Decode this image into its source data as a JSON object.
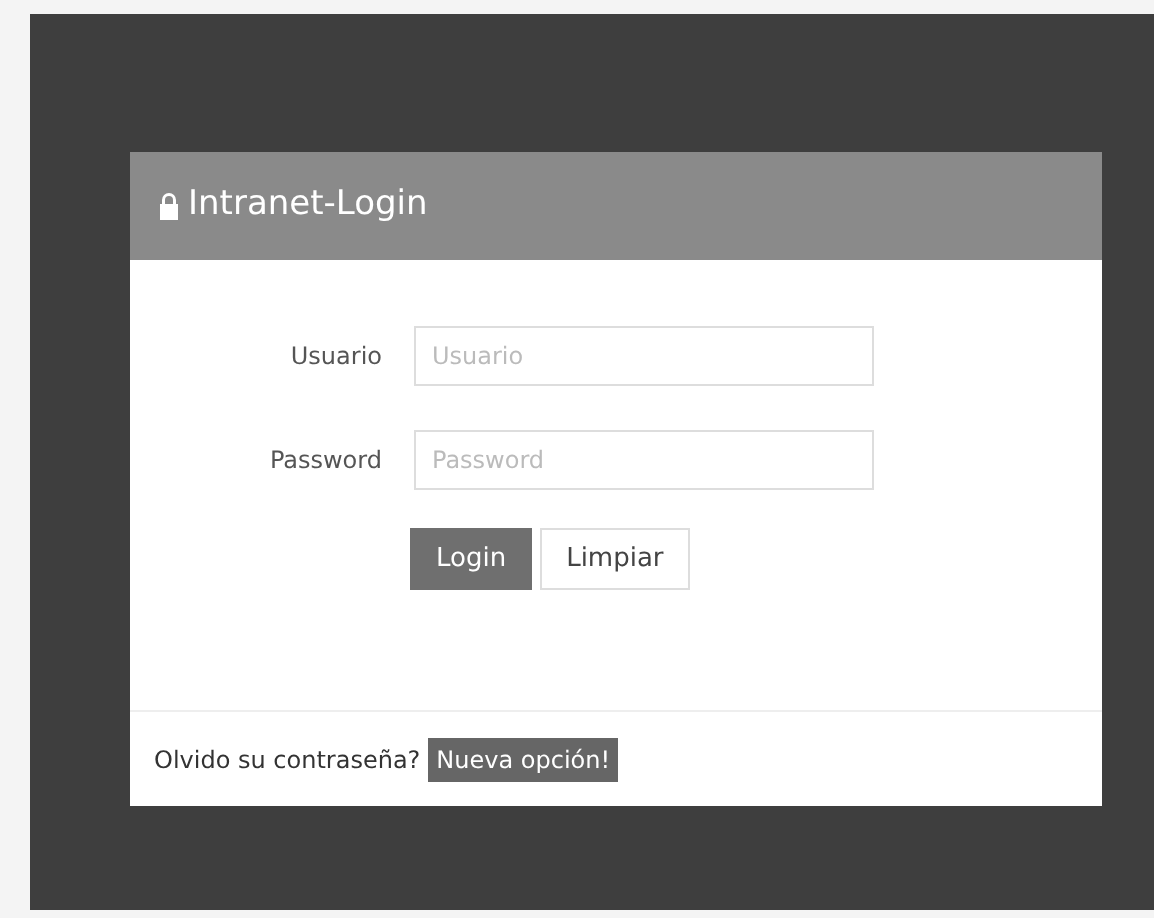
{
  "panel": {
    "title": "Intranet-Login"
  },
  "fields": [
    {
      "label": "Usuario",
      "placeholder": "Usuario"
    },
    {
      "label": "Password",
      "placeholder": "Password"
    }
  ],
  "buttons": [
    {
      "label": "Login",
      "kind": "primary"
    },
    {
      "label": "Limpiar",
      "kind": "default"
    }
  ],
  "footer": {
    "text": "Olvido su contraseña?",
    "badge": "Nueva opción!"
  }
}
